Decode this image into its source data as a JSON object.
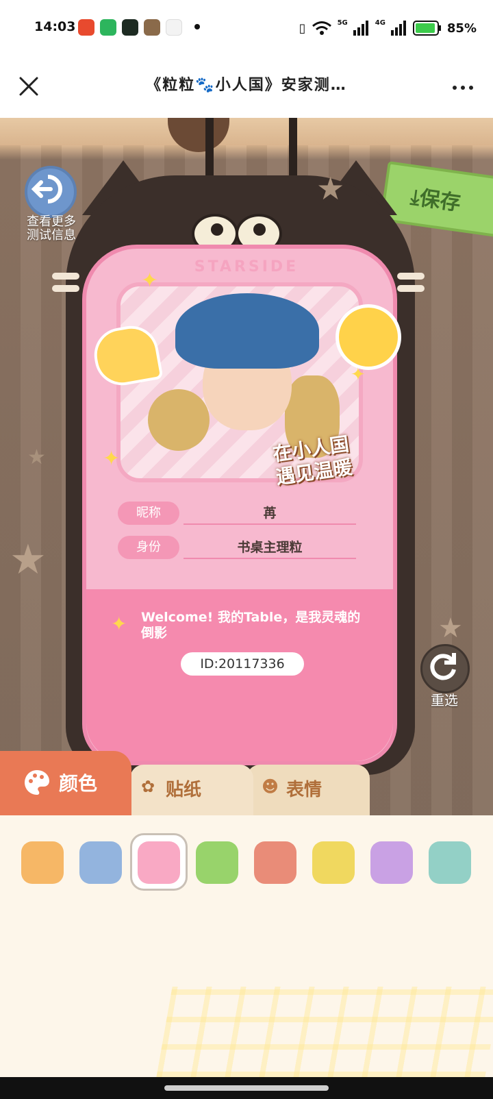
{
  "status": {
    "time": "14:03",
    "signal1_label": "5G",
    "signal2_label": "4G",
    "battery": "85%"
  },
  "header": {
    "title": "《粒粒🐾小人国》安家测…"
  },
  "scene": {
    "back_label_line1": "查看更多",
    "back_label_line2": "测试信息",
    "save_label": "保存",
    "refresh_label": "重选"
  },
  "card": {
    "brand": "STARSIDE",
    "slogan_line1": "在小人国",
    "slogan_line2": "遇见温暖",
    "nickname_label": "昵称",
    "nickname_value": "苒",
    "identity_label": "身份",
    "identity_value": "书桌主理粒",
    "welcome_text": "Welcome! 我的Table，是我灵魂的倒影",
    "id_text": "ID:20117336"
  },
  "tabs": [
    {
      "label": "颜色",
      "icon": "palette-icon",
      "active": true
    },
    {
      "label": "贴纸",
      "icon": "sticker-icon",
      "active": false
    },
    {
      "label": "表情",
      "icon": "face-icon",
      "active": false
    }
  ],
  "palette": {
    "colors": [
      "#f6b766",
      "#93b4de",
      "#f9a9c4",
      "#98d36b",
      "#e98c78",
      "#f0d85f",
      "#c9a1e4",
      "#93d0c6"
    ],
    "selected_index": 2
  }
}
